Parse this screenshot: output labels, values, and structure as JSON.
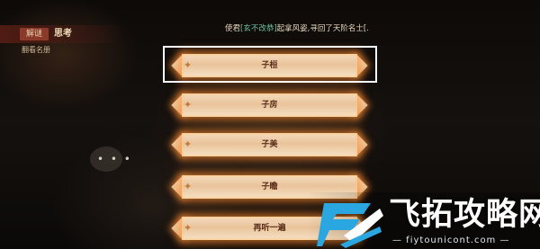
{
  "header": {
    "badge": "解谜",
    "title": "思考",
    "subtitle": "翻看名册"
  },
  "dialog": {
    "prefix": "使君",
    "highlight": "[玄不改恭]",
    "suffix": "起拿风姿,寻回了天阶名士[."
  },
  "chat": {
    "dots": "• • •"
  },
  "options": [
    {
      "label": "子桓",
      "selected": true
    },
    {
      "label": "子房",
      "selected": false
    },
    {
      "label": "子美",
      "selected": false
    },
    {
      "label": "子瞻",
      "selected": false
    },
    {
      "label": "再听一遍",
      "selected": false
    }
  ],
  "watermark": {
    "brand": "飞拓攻略网",
    "url": "— fiytounicont.com —",
    "logo_color": "#2aa6e0"
  }
}
